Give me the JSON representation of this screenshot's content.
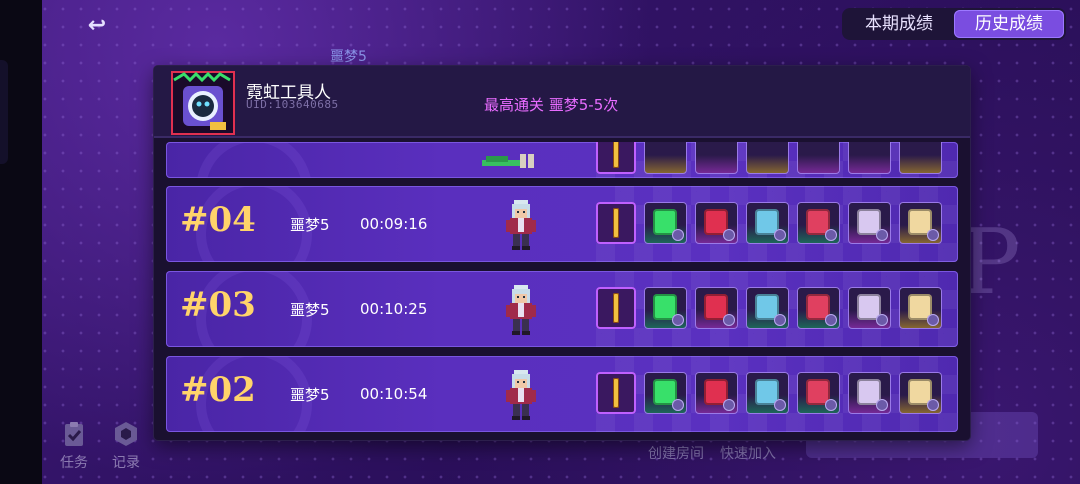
{
  "tabs": [
    {
      "label": "本期成绩",
      "active": false
    },
    {
      "label": "历史成绩",
      "active": true
    }
  ],
  "background": {
    "label": "噩梦5",
    "side_buttons": [
      {
        "label": "任务",
        "icon": "clipboard-check-icon"
      },
      {
        "label": "记录",
        "icon": "hexagon-badge-icon"
      }
    ],
    "bottom_links": [
      "创建房间",
      "快速加入"
    ]
  },
  "player": {
    "name": "霓虹工具人",
    "uid": "UID:103640685",
    "best_clear": "最高通关  噩梦5-5次"
  },
  "records": [
    {
      "rank": "#04",
      "level": "噩梦5",
      "time": "00:09:16"
    },
    {
      "rank": "#03",
      "level": "噩梦5",
      "time": "00:10:25"
    },
    {
      "rank": "#02",
      "level": "噩梦5",
      "time": "00:10:54"
    }
  ],
  "items": [
    {
      "icon": "golden-staff-icon",
      "rarity": "weapon",
      "color": "#f2c040"
    },
    {
      "icon": "green-crystal-icon",
      "rarity": "g",
      "color": "#38e06a"
    },
    {
      "icon": "red-orb-icon",
      "rarity": "p",
      "color": "#e03050"
    },
    {
      "icon": "tablet-device-icon",
      "rarity": "g",
      "color": "#70c8e8"
    },
    {
      "icon": "heart-pendant-icon",
      "rarity": "g",
      "color": "#e04060"
    },
    {
      "icon": "rune-card-icon",
      "rarity": "p",
      "color": "#d8c8f0"
    },
    {
      "icon": "scroll-map-icon",
      "rarity": "o",
      "color": "#f0d8a0"
    }
  ],
  "colors": {
    "rank": "#ffd46a",
    "best_clear": "#e86cff",
    "tab_active": "#7a4de0"
  }
}
